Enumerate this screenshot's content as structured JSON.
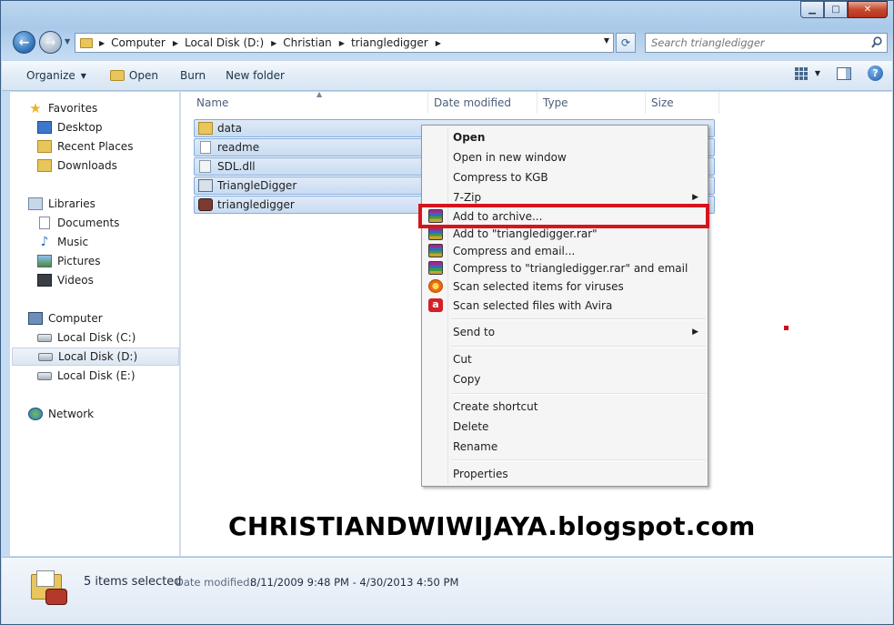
{
  "window": {
    "controls": {
      "minimize": "▁",
      "maximize": "□",
      "close": "✕"
    }
  },
  "nav": {
    "back_icon": "back-arrow-icon",
    "forward_icon": "forward-arrow-icon",
    "breadcrumbs": [
      "Computer",
      "Local Disk (D:)",
      "Christian",
      "triangledigger"
    ],
    "search_placeholder": "Search triangledigger"
  },
  "toolbar": {
    "organize_label": "Organize",
    "open_label": "Open",
    "burn_label": "Burn",
    "new_folder_label": "New folder"
  },
  "navpane": {
    "favorites_label": "Favorites",
    "favorites": [
      "Desktop",
      "Recent Places",
      "Downloads"
    ],
    "libraries_label": "Libraries",
    "libraries": [
      "Documents",
      "Music",
      "Pictures",
      "Videos"
    ],
    "computer_label": "Computer",
    "drives": [
      "Local Disk (C:)",
      "Local Disk (D:)",
      "Local Disk (E:)"
    ],
    "selected_drive": "Local Disk (D:)",
    "network_label": "Network"
  },
  "columns": {
    "name": "Name",
    "date_modified": "Date modified",
    "type": "Type",
    "size": "Size"
  },
  "files": [
    {
      "name": "data",
      "kind": "folder"
    },
    {
      "name": "readme",
      "kind": "text"
    },
    {
      "name": "SDL.dll",
      "kind": "dll"
    },
    {
      "name": "TriangleDigger",
      "kind": "exe"
    },
    {
      "name": "triangledigger",
      "kind": "app"
    }
  ],
  "context_menu": {
    "open": "Open",
    "open_new_window": "Open in new window",
    "compress_kgb": "Compress to KGB",
    "seven_zip": "7-Zip",
    "add_to_archive": "Add to archive...",
    "add_to_rar": "Add to \"triangledigger.rar\"",
    "compress_email": "Compress and email...",
    "compress_rar_email": "Compress to \"triangledigger.rar\" and email",
    "scan_viruses": "Scan selected items for viruses",
    "scan_avira": "Scan selected files with Avira",
    "send_to": "Send to",
    "cut": "Cut",
    "copy": "Copy",
    "create_shortcut": "Create shortcut",
    "delete": "Delete",
    "rename": "Rename",
    "properties": "Properties"
  },
  "watermark": "CHRISTIANDWIWIJAYA.blogspot.com",
  "details": {
    "count": "5 items selected",
    "date_label": "Date modified:",
    "date_value": "8/11/2009 9:48 PM - 4/30/2013 4:50 PM"
  },
  "colors": {
    "highlight_box": "#d6141c",
    "selection": "#c9dcf2"
  }
}
